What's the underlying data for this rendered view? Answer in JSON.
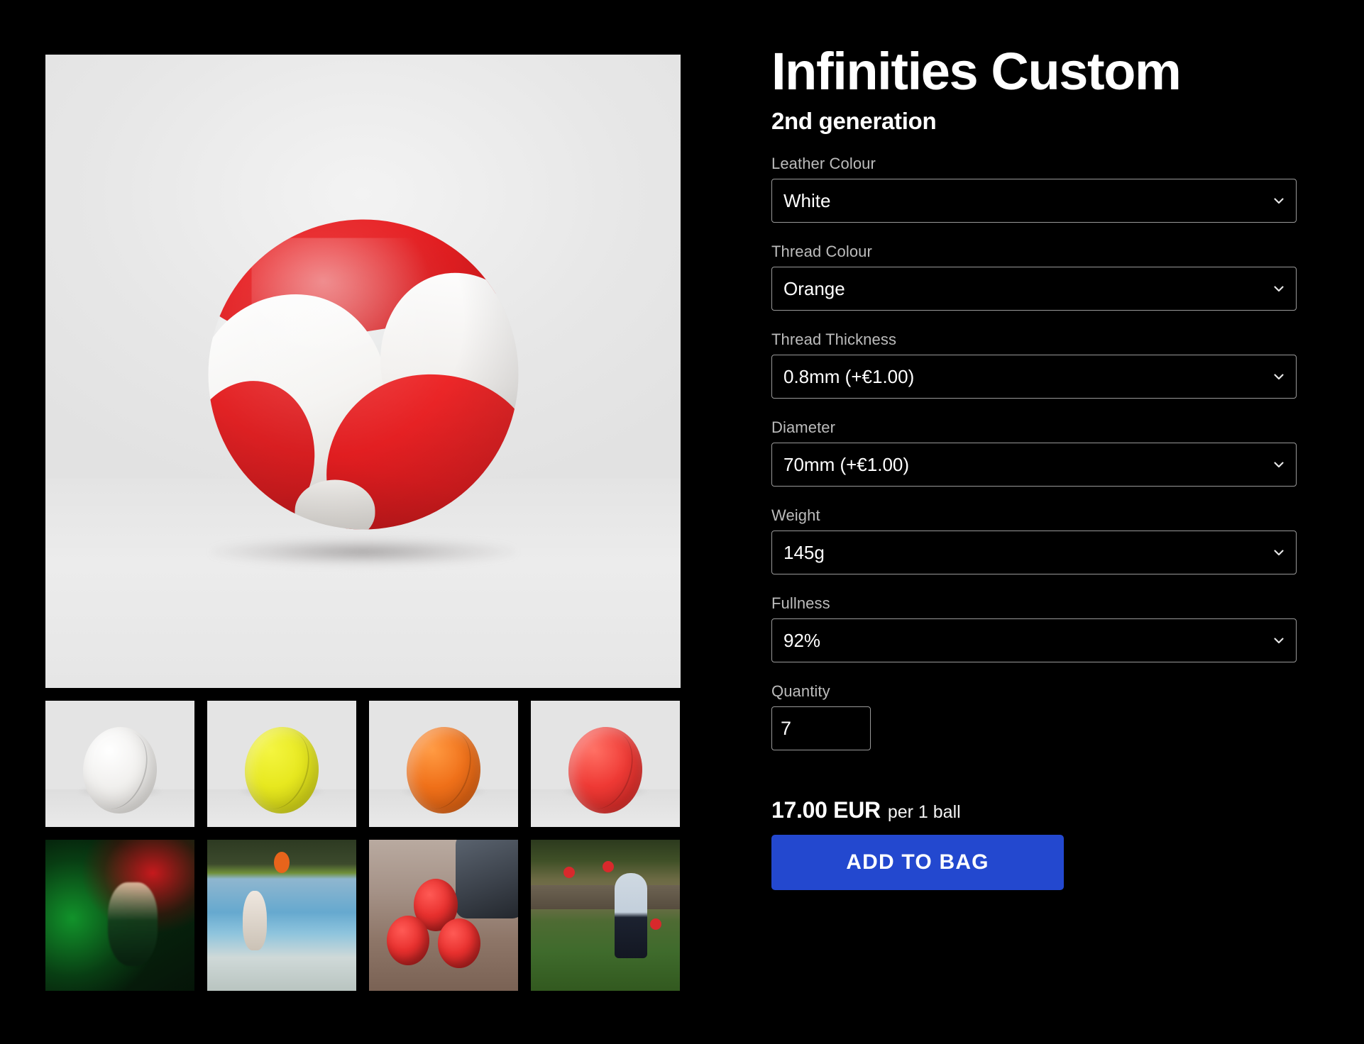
{
  "product": {
    "title": "Infinities Custom",
    "subtitle": "2nd generation"
  },
  "options": [
    {
      "label": "Leather Colour",
      "value": "White",
      "name": "leather-colour"
    },
    {
      "label": "Thread Colour",
      "value": "Orange",
      "name": "thread-colour"
    },
    {
      "label": "Thread Thickness",
      "value": "0.8mm (+€1.00)",
      "name": "thread-thickness"
    },
    {
      "label": "Diameter",
      "value": "70mm (+€1.00)",
      "name": "diameter"
    },
    {
      "label": "Weight",
      "value": "145g",
      "name": "weight"
    },
    {
      "label": "Fullness",
      "value": "92%",
      "name": "fullness"
    }
  ],
  "quantity": {
    "label": "Quantity",
    "value": "7"
  },
  "price": {
    "amount": "17.00 EUR",
    "unit": "per 1 ball"
  },
  "cta": {
    "label": "ADD TO BAG",
    "color": "#2348cf"
  },
  "gallery": {
    "hero": {
      "alt": "Red and white juggling ball on light grey background",
      "ball_colors": [
        "#e8302e",
        "#ffffff"
      ],
      "background": "#e9e9e9"
    },
    "thumbnails": [
      {
        "alt": "White juggling ball",
        "color": "#f0efed"
      },
      {
        "alt": "Yellow juggling ball",
        "color": "#e7e81f"
      },
      {
        "alt": "Orange juggling ball",
        "color": "#f0711a"
      },
      {
        "alt": "Red juggling ball",
        "color": "#ef3a35"
      }
    ],
    "videos": [
      {
        "alt": "Juggler on stage with green and red lasers"
      },
      {
        "alt": "Juggler beside swimming pool with orange balls"
      },
      {
        "alt": "Hand holding three red juggling balls"
      },
      {
        "alt": "Girl juggling red balls on grass outdoors"
      }
    ]
  }
}
